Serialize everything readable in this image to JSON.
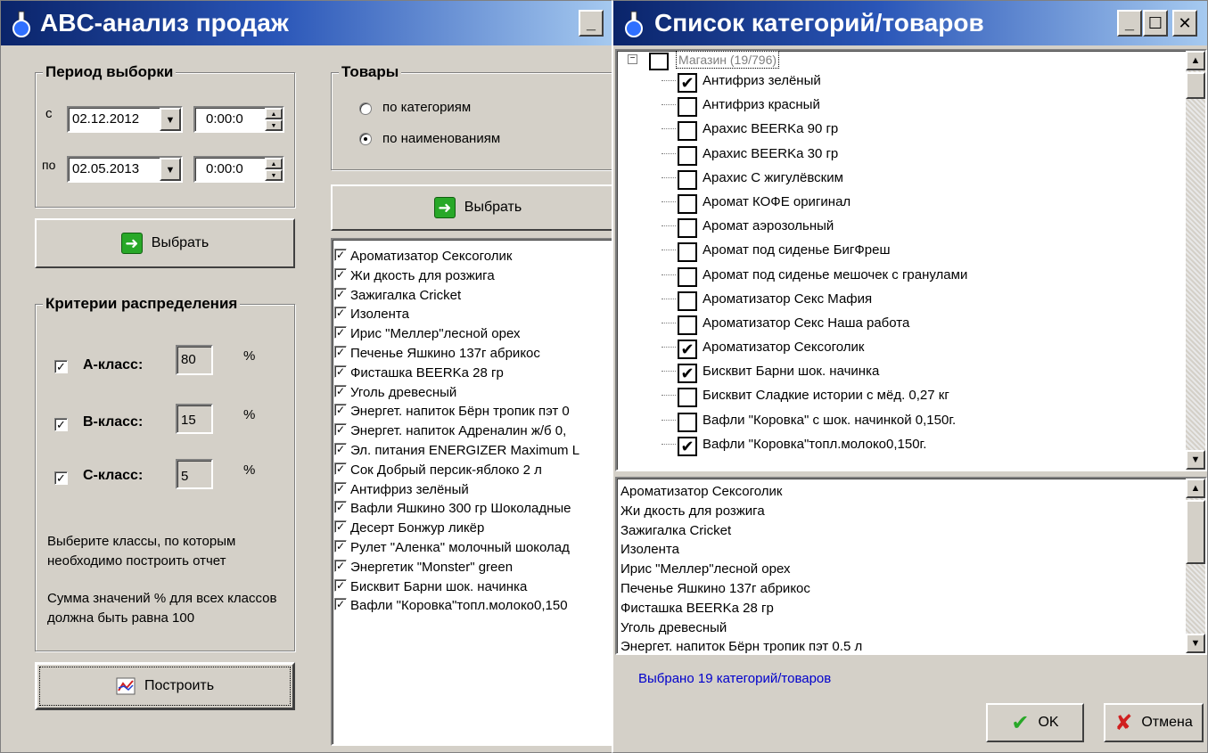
{
  "abc_window": {
    "title": "ABC-анализ продаж",
    "period": {
      "title": "Период выборки",
      "from_label": "с",
      "to_label": "по",
      "from_date": "02.12.2012",
      "from_time": "0:00:0",
      "to_date": "02.05.2013",
      "to_time": "0:00:0",
      "select_label": "Выбрать"
    },
    "goods": {
      "title": "Товары",
      "by_categories": "по категориям",
      "by_names": "по наименованиям",
      "selected_mode": "by_names",
      "select_label": "Выбрать"
    },
    "criteria": {
      "title": "Критерии распределения",
      "classes": [
        {
          "label": "A-класс:",
          "value": "80",
          "unit": "%",
          "checked": true
        },
        {
          "label": "B-класс:",
          "value": "15",
          "unit": "%",
          "checked": true
        },
        {
          "label": "C-класс:",
          "value": "5",
          "unit": "%",
          "checked": true
        }
      ],
      "hint1": "Выберите классы, по которым необходимо построить отчет",
      "hint2": "Сумма значений % для всех классов должна быть равна 100"
    },
    "build_label": "Построить",
    "items": [
      "Ароматизатор Сексоголик",
      "Жи дкость для розжига",
      "Зажигалка Cricket",
      "Изолента",
      "Ирис \"Меллер\"лесной орех",
      "Печенье Яшкино 137г абрикос",
      "Фисташка BEERKa  28 гр",
      "Уголь древесный",
      "Энергет. напиток Бёрн тропик пэт 0",
      "Энергет. напиток Адреналин ж/б 0,",
      "Эл. питания ENERGIZER Maximum L",
      "Сок Добрый персик-яблоко 2 л",
      "Антифриз зелёный",
      "Вафли Яшкино 300 гр Шоколадные",
      "Десерт Бонжур ликёр",
      "Рулет \"Аленка\" молочный шоколад",
      "Энергетик \"Monster\" green",
      "Бисквит Барни шок. начинка",
      "Вафли \"Коровка\"топл.молоко0,150"
    ]
  },
  "list_window": {
    "title": "Список категорий/товаров",
    "root_label": "Магазин (19/796)",
    "tree_items": [
      {
        "label": "Антифриз зелёный",
        "checked": true
      },
      {
        "label": "Антифриз красный",
        "checked": false
      },
      {
        "label": "Арахис BEERKa  90 гр",
        "checked": false
      },
      {
        "label": "Арахис BEERKa 30 гр",
        "checked": false
      },
      {
        "label": "Арахис С жигулёвским",
        "checked": false
      },
      {
        "label": "Аромат КОФЕ оригинал",
        "checked": false
      },
      {
        "label": "Аромат аэрозольный",
        "checked": false
      },
      {
        "label": "Аромат под сиденье БигФреш",
        "checked": false
      },
      {
        "label": "Аромат под сиденье мешочек с гранулами",
        "checked": false
      },
      {
        "label": "Ароматизатор Секс Мафия",
        "checked": false
      },
      {
        "label": "Ароматизатор Секс Наша работа",
        "checked": false
      },
      {
        "label": "Ароматизатор Сексоголик",
        "checked": true
      },
      {
        "label": "Бисквит Барни шок. начинка",
        "checked": true
      },
      {
        "label": "Бисквит Сладкие истории с мёд. 0,27 кг",
        "checked": false
      },
      {
        "label": "Вафли \"Коровка\" с шок. начинкой 0,150г.",
        "checked": false
      },
      {
        "label": "Вафли \"Коровка\"топл.молоко0,150г.",
        "checked": true
      }
    ],
    "selected_items": [
      "Ароматизатор Сексоголик",
      "Жи дкость для розжига",
      "Зажигалка Cricket",
      "Изолента",
      "Ирис \"Меллер\"лесной орех",
      "Печенье Яшкино 137г абрикос",
      "Фисташка BEERKa  28 гр",
      "Уголь древесный",
      "Энергет. напиток Бёрн тропик пэт 0.5 л"
    ],
    "status": "Выбрано 19 категорий/товаров",
    "ok_label": "OK",
    "cancel_label": "Отмена"
  },
  "colors": {
    "title_start": "#0a246a",
    "title_end": "#a6caf0",
    "status_text": "#0000cc",
    "face": "#d4d0c8"
  }
}
